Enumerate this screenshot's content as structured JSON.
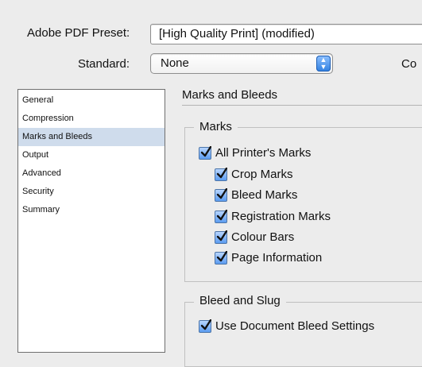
{
  "preset": {
    "label": "Adobe PDF Preset:",
    "value": "[High Quality Print] (modified)"
  },
  "standard": {
    "label": "Standard:",
    "value": "None"
  },
  "compatibility": {
    "label_partial": "Co"
  },
  "categories": [
    "General",
    "Compression",
    "Marks and Bleeds",
    "Output",
    "Advanced",
    "Security",
    "Summary"
  ],
  "selected_category": "Marks and Bleeds",
  "panel": {
    "title": "Marks and Bleeds",
    "marks_group": {
      "legend": "Marks",
      "all_printers_marks": {
        "label": "All Printer's Marks",
        "checked": true
      },
      "items": [
        {
          "label": "Crop Marks",
          "checked": true
        },
        {
          "label": "Bleed Marks",
          "checked": true
        },
        {
          "label": "Registration Marks",
          "checked": true
        },
        {
          "label": "Colour Bars",
          "checked": true
        },
        {
          "label": "Page Information",
          "checked": true
        }
      ]
    },
    "bleed_group": {
      "legend": "Bleed and Slug",
      "use_document_bleed": {
        "label": "Use Document Bleed Settings",
        "checked": true
      }
    }
  },
  "colors": {
    "window_bg": "#ececec",
    "selection": "#cfdcec",
    "checkbox_blue": "#5b9cf0"
  }
}
